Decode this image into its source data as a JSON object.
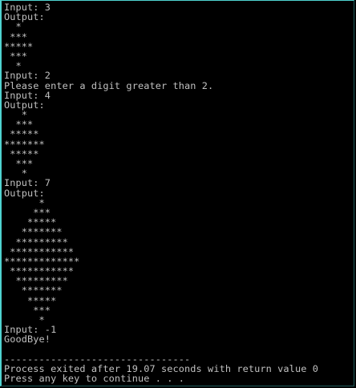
{
  "console": {
    "lines": [
      "Input: 3",
      "Output:",
      "  *",
      " ***",
      "*****",
      " ***",
      "  *",
      "Input: 2",
      "Please enter a digit greater than 2.",
      "Input: 4",
      "Output:",
      "   *",
      "  ***",
      " *****",
      "*******",
      " *****",
      "  ***",
      "   *",
      "Input: 7",
      "Output:",
      "      *",
      "     ***",
      "    *****",
      "   *******",
      "  *********",
      " ***********",
      "*************",
      " ***********",
      "  *********",
      "   *******",
      "    *****",
      "     ***",
      "      *",
      "Input: -1",
      "GoodBye!",
      "",
      "--------------------------------",
      "Process exited after 19.07 seconds with return value 0",
      "Press any key to continue . . ."
    ]
  },
  "colors": {
    "background": "#000000",
    "text": "#c0c0c0",
    "border_accent": "#4fd3d0"
  }
}
